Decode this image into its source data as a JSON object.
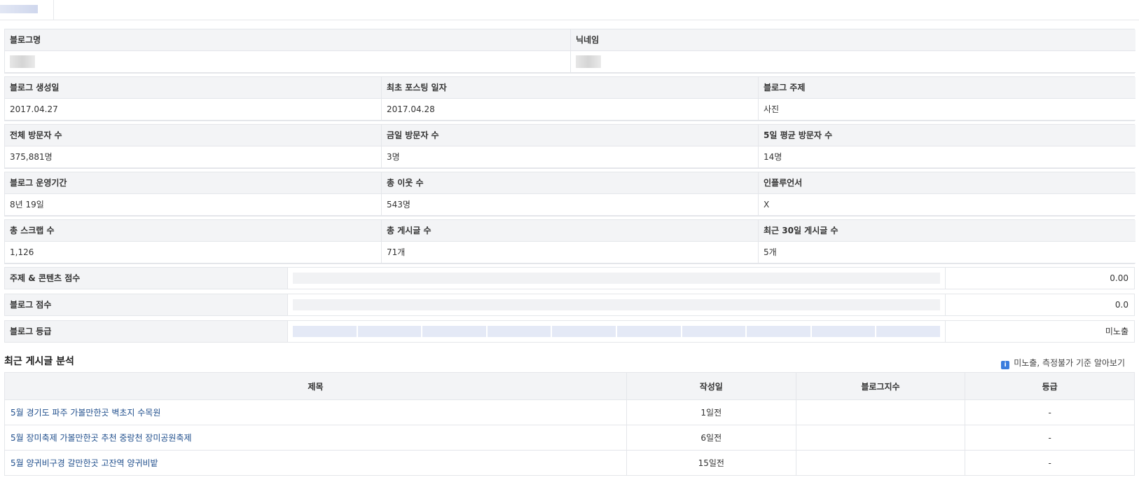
{
  "info": {
    "blog_name_label": "블로그명",
    "nickname_label": "닉네임",
    "created_label": "블로그 생성일",
    "created_value": "2017.04.27",
    "first_post_label": "최초 포스팅 일자",
    "first_post_value": "2017.04.28",
    "topic_label": "블로그 주제",
    "topic_value": "사진",
    "total_visitors_label": "전체 방문자 수",
    "total_visitors_value": "375,881명",
    "today_visitors_label": "금일 방문자 수",
    "today_visitors_value": "3명",
    "avg5_label": "5일 평균 방문자 수",
    "avg5_value": "14명",
    "period_label": "블로그 운영기간",
    "period_value": "8년 19일",
    "neighbors_label": "총 이웃 수",
    "neighbors_value": "543명",
    "influencer_label": "인플루언서",
    "influencer_value": "X",
    "scraps_label": "총 스크랩 수",
    "scraps_value": "1,126",
    "posts_label": "총 게시글 수",
    "posts_value": "71개",
    "recent30_label": "최근 30일 게시글 수",
    "recent30_value": "5개"
  },
  "scores": {
    "topic_content_label": "주제 & 콘텐츠 점수",
    "topic_content_value": "0.00",
    "topic_content_fill": 0,
    "blog_score_label": "블로그 점수",
    "blog_score_value": "0.0",
    "blog_score_fill": 0,
    "grade_label": "블로그 등급",
    "grade_value": "미노출"
  },
  "recent": {
    "title": "최근 게시글 분석",
    "help_link": "미노출, 측정불가 기준 알아보기",
    "columns": [
      "제목",
      "작성일",
      "블로그지수",
      "등급"
    ],
    "rows": [
      {
        "title": "5월 경기도 파주 가볼만한곳 벽초지 수목원",
        "date": "1일전",
        "index": "",
        "grade": "-"
      },
      {
        "title": "5월 장미축제 가볼만한곳 추천 중랑천 장미공원축제",
        "date": "6일전",
        "index": "",
        "grade": "-"
      },
      {
        "title": "5월 양귀비구경 갈만한곳 고잔역 양귀비밭",
        "date": "15일전",
        "index": "",
        "grade": "-"
      }
    ]
  }
}
